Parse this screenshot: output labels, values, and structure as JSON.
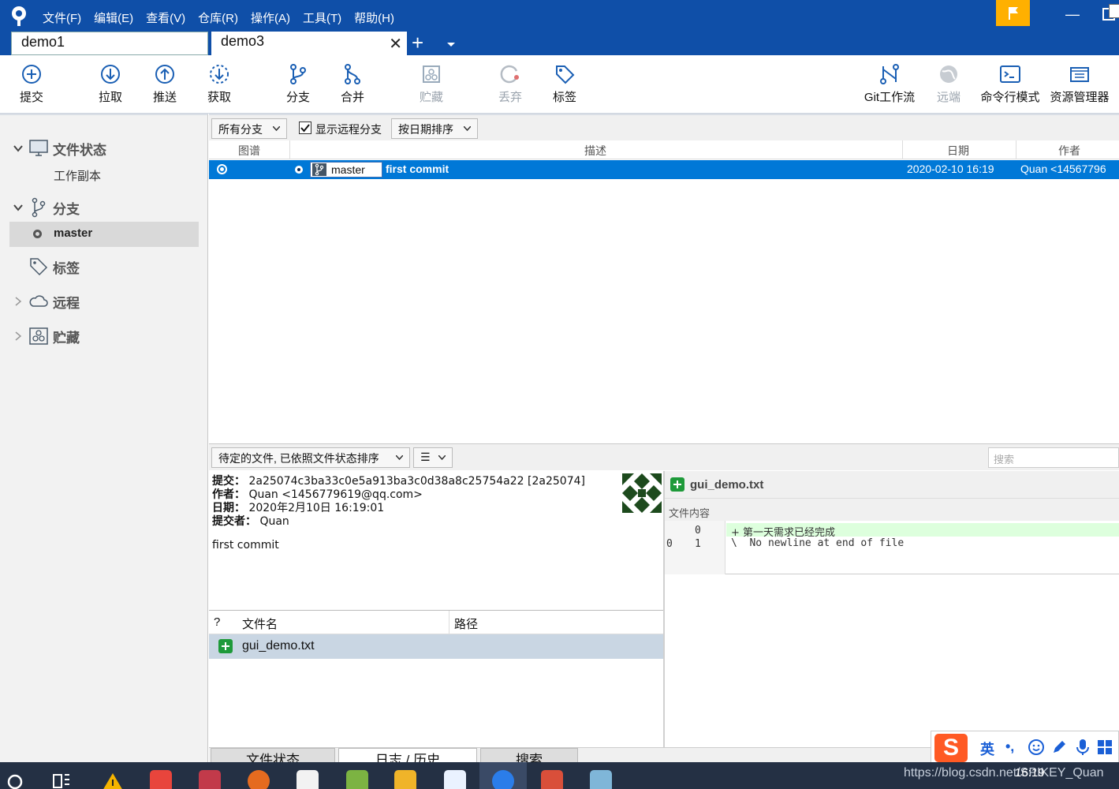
{
  "titlebar": {
    "menu": [
      "文件(F)",
      "编辑(E)",
      "查看(V)",
      "仓库(R)",
      "操作(A)",
      "工具(T)",
      "帮助(H)"
    ],
    "tabs": [
      {
        "label": "demo1"
      },
      {
        "label": "demo3"
      }
    ],
    "close_glyph": "✕",
    "add_glyph": "+",
    "minimize_glyph": "—"
  },
  "toolbar": {
    "commit": "提交",
    "pull": "拉取",
    "push": "推送",
    "fetch": "获取",
    "branch": "分支",
    "merge": "合并",
    "stash": "贮藏",
    "discard": "丢弃",
    "tag": "标签",
    "gitflow": "Git工作流",
    "remote": "远端",
    "terminal": "命令行模式",
    "explorer": "资源管理器"
  },
  "sidebar": {
    "file_status": "文件状态",
    "working_copy": "工作副本",
    "branches": "分支",
    "current_branch": "master",
    "tags": "标签",
    "remotes": "远程",
    "stashes": "贮藏"
  },
  "filter": {
    "branches_dropdown": "所有分支",
    "show_remote": "显示远程分支",
    "show_remote_checked": true,
    "sort_dropdown": "按日期排序"
  },
  "commits": {
    "headers": {
      "graph": "图谱",
      "description": "描述",
      "date": "日期",
      "author": "作者"
    },
    "rows": [
      {
        "branch": "master",
        "message": "first commit",
        "date": "2020-02-10 16:19",
        "author": "Quan <14567796"
      }
    ]
  },
  "lower": {
    "file_sort_dropdown": "待定的文件, 已依照文件状态排序",
    "view_toggle": "☰",
    "search_placeholder": "搜索"
  },
  "details": {
    "commit_key": "提交：",
    "commit_val": "2a25074c3ba33c0e5a913ba3c0d38a8c25754a22 [2a25074]",
    "author_key": "作者：",
    "author_val": "Quan <1456779619@qq.com>",
    "date_key": "日期：",
    "date_val": "2020年2月10日 16:19:01",
    "committer_key": "提交者：",
    "committer_val": "Quan",
    "message": "first commit"
  },
  "files": {
    "headers": {
      "status": "?",
      "name": "文件名",
      "path": "路径"
    },
    "rows": [
      {
        "name": "gui_demo.txt"
      }
    ]
  },
  "diff": {
    "filename": "gui_demo.txt",
    "section_label": "文件内容",
    "lines": [
      {
        "old": "",
        "new": "0",
        "text": "+ 第一天需求已经完成"
      },
      {
        "old": "0",
        "new": "1",
        "text": "\\  No newline at end of file"
      }
    ]
  },
  "bottom_tabs": [
    "文件状态",
    "日志 / 历史",
    "搜索"
  ],
  "ime": {
    "logo": "S",
    "lang": "英",
    "punct": "•,"
  },
  "taskbar": {
    "watermark": "https://blog.csdn.net/SPIKEY_Quan",
    "time": "16:19"
  },
  "colors": {
    "titlebar": "#0f4fa8",
    "selection": "#0078d7",
    "flag": "#ffb000",
    "added": "#1e9a3a"
  }
}
